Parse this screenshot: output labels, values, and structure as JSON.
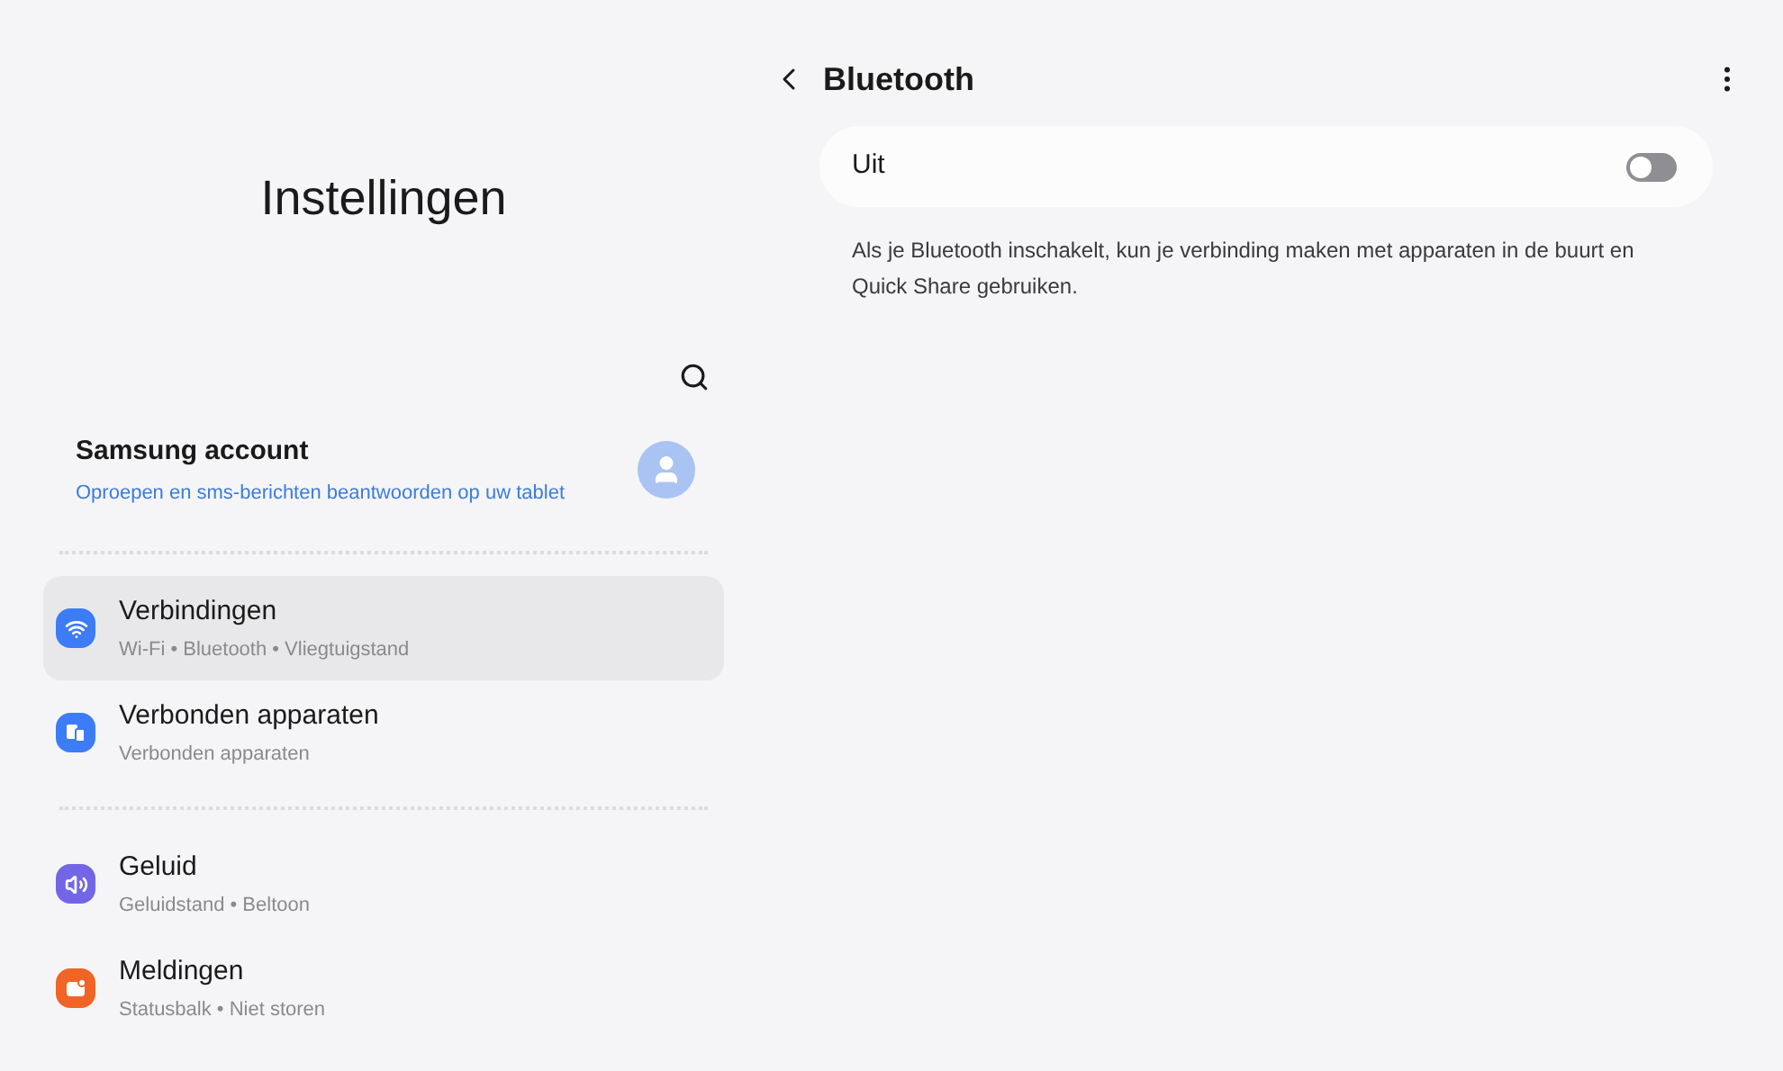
{
  "sidebar": {
    "title": "Instellingen",
    "account": {
      "name": "Samsung account",
      "subtitle": "Oproepen en sms-berichten beantwoorden op uw tablet"
    },
    "groups": [
      [
        {
          "kind": "wifi",
          "color": "#3d7cf7",
          "label": "Verbindingen",
          "subtitle": "Wi-Fi • Bluetooth • Vliegtuigstand",
          "selected": true
        },
        {
          "kind": "devices",
          "color": "#3d7cf7",
          "label": "Verbonden apparaten",
          "subtitle": "Verbonden apparaten",
          "selected": false
        }
      ],
      [
        {
          "kind": "sound",
          "color": "#7266e6",
          "label": "Geluid",
          "subtitle": "Geluidstand • Beltoon",
          "selected": false
        },
        {
          "kind": "notification",
          "color": "#f06426",
          "label": "Meldingen",
          "subtitle": "Statusbalk • Niet storen",
          "selected": false
        }
      ]
    ]
  },
  "detail": {
    "title": "Bluetooth",
    "toggle": {
      "label": "Uit",
      "on": false
    },
    "description": "Als je Bluetooth inschakelt, kun je verbinding maken met apparaten in de buurt en Quick Share gebruiken."
  }
}
